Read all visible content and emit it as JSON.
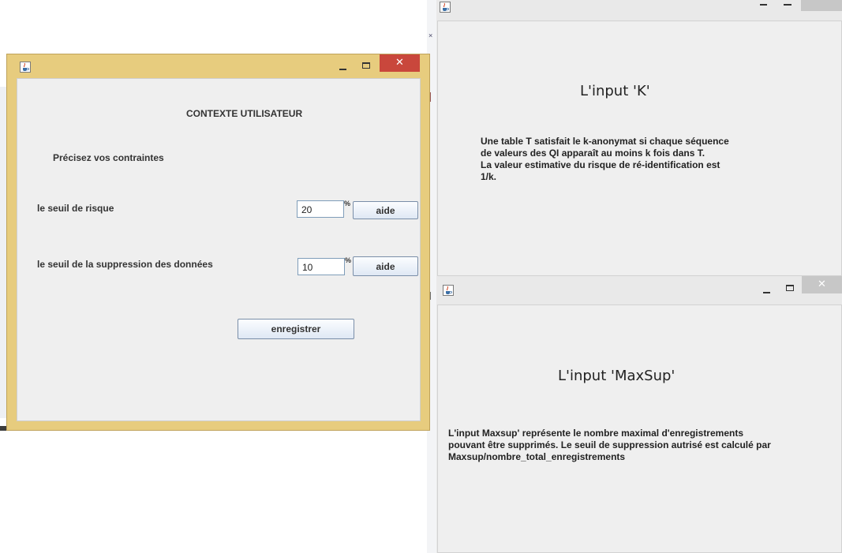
{
  "form_window": {
    "minimize_glyph": "–",
    "maximize_glyph": "□",
    "close_glyph": "✕",
    "title": "CONTEXTE UTILISATEUR",
    "subtitle": "Précisez vos contraintes",
    "risk_label": "le seuil de risque",
    "risk_value": "20",
    "risk_unit": "%",
    "risk_help_label": "aide",
    "suppression_label": "le seuil de la suppression des données",
    "suppression_value": "10",
    "suppression_unit": "%",
    "suppression_help_label": "aide",
    "save_label": "enregistrer"
  },
  "k_window": {
    "heading": "L'input 'K'",
    "lines": [
      "Une table T satisfait le k-anonymat si chaque séquence",
      "de valeurs des QI apparaît au moins k fois dans T.",
      "La valeur estimative du risque de ré-identification est",
      "1/k."
    ]
  },
  "maxsup_window": {
    "minimize_glyph": "–",
    "maximize_glyph": "□",
    "close_glyph": "✕",
    "heading": "L'input 'MaxSup'",
    "lines": [
      "L'input Maxsup' représente le nombre maximal d'enregistrements",
      "pouvant être supprimés. Le seuil de suppression autrisé est calculé par",
      "Maxsup/nombre_total_enregistrements"
    ]
  },
  "colors": {
    "form_frame": "#e7cc7e",
    "close_active": "#c9473c",
    "panel_bg": "#efefef"
  },
  "icons": {
    "app": "java-coffee-cup-icon",
    "minimize": "minimize-icon",
    "maximize": "maximize-icon",
    "close": "close-icon"
  }
}
